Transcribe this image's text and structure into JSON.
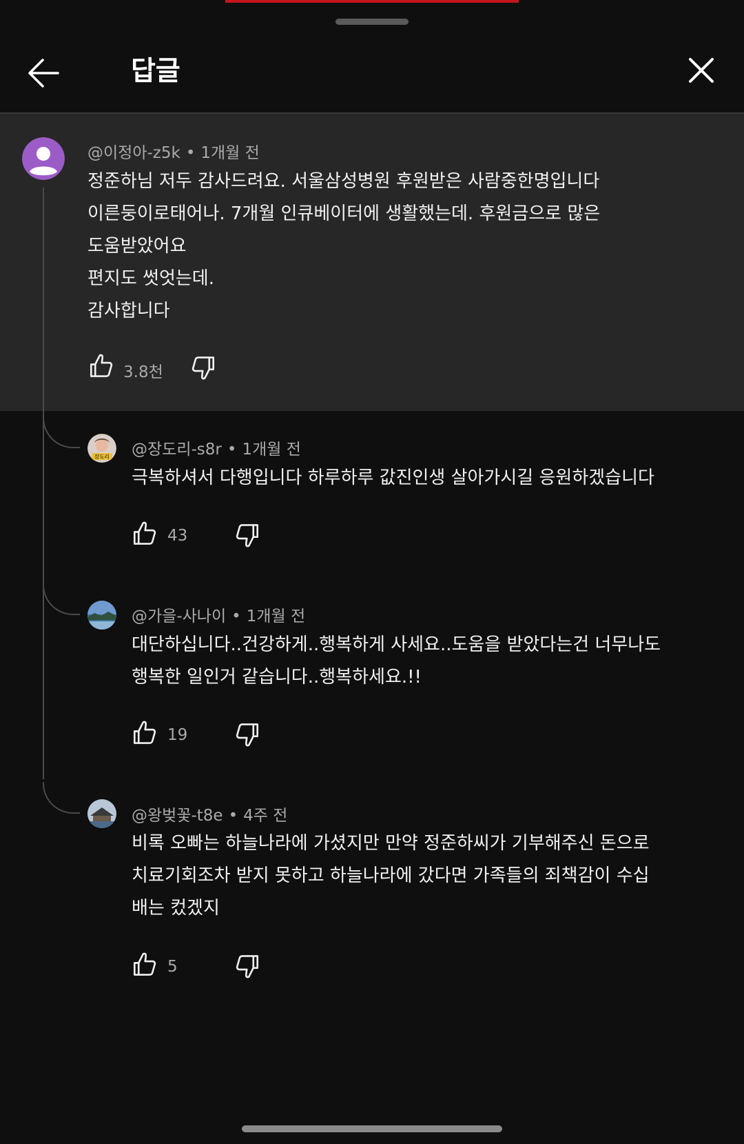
{
  "header": {
    "title": "답글"
  },
  "parent": {
    "author": "@이정아-z5k",
    "time": "1개월 전",
    "lines": [
      "정준하님 저두 감사드려요. 서울삼성병원 후원받은 사람중한명입니다",
      "이른둥이로태어나. 7개월 인큐베이터에 생활했는데. 후원금으로 많은",
      "도움받았어요",
      "편지도 썻엇는데.",
      "감사합니다"
    ],
    "likes": "3.8천"
  },
  "replies": [
    {
      "author": "@장도리-s8r",
      "time": "1개월 전",
      "avatar_text": "장도리",
      "lines": [
        "극복하셔서 다행입니다 하루하루 값진인생 살아가시길 응원하겠습니다"
      ],
      "likes": "43"
    },
    {
      "author": "@가을-사나이",
      "time": "1개월 전",
      "lines": [
        "대단하십니다..건강하게..행복하게 사세요..도움을 받았다는건 너무나도",
        "행복한 일인거 같습니다..행복하세요.!!"
      ],
      "likes": "19"
    },
    {
      "author": "@왕벚꽃-t8e",
      "time": "4주 전",
      "lines": [
        "비록 오빠는 하늘나라에 가셨지만  만약 정준하씨가 기부해주신 돈으로",
        "치료기회조차 받지 못하고 하늘나라에 갔다면 가족들의 죄책감이  수십",
        "배는 컸겠지"
      ],
      "likes": "5"
    }
  ],
  "meta_separator": "•",
  "icons": {
    "back": "arrow-left-icon",
    "close": "close-icon",
    "like": "thumbs-up-icon",
    "dislike": "thumbs-down-icon"
  },
  "colors": {
    "background": "#0f0f0f",
    "highlight": "#272727",
    "accent": "#c4161c",
    "avatar_purple": "#9c5cc8"
  }
}
